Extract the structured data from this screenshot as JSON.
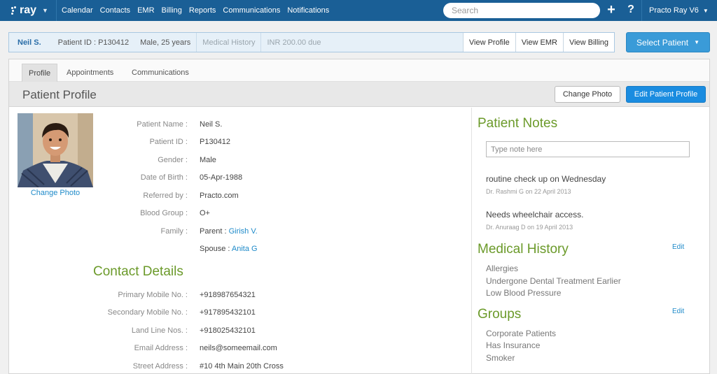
{
  "nav": {
    "logo": "ray",
    "links": [
      "Calendar",
      "Contacts",
      "EMR",
      "Billing",
      "Reports",
      "Communications",
      "Notifications"
    ],
    "search_placeholder": "Search",
    "plus": "+",
    "help": "?",
    "user": "Practo Ray V6"
  },
  "patient_bar": {
    "name": "Neil S.",
    "patient_id": "Patient ID : P130412",
    "gender_age": "Male, 25 years",
    "medical_history": "Medical History",
    "due": "INR 200.00 due",
    "view_profile": "View Profile",
    "view_emr": "View EMR",
    "view_billing": "View Billing",
    "select_patient": "Select Patient"
  },
  "tabs": [
    "Profile",
    "Appointments",
    "Communications"
  ],
  "profile": {
    "title": "Patient Profile",
    "change_photo_btn": "Change Photo",
    "edit_profile_btn": "Edit Patient Profile",
    "change_photo_link": "Change Photo",
    "fields": [
      {
        "label": "Patient Name :",
        "value": "Neil S."
      },
      {
        "label": "Patient ID :",
        "value": "P130412"
      },
      {
        "label": "Gender :",
        "value": "Male"
      },
      {
        "label": "Date of Birth :",
        "value": "05-Apr-1988"
      },
      {
        "label": "Referred by :",
        "value": "Practo.com"
      },
      {
        "label": "Blood Group :",
        "value": "O+"
      }
    ],
    "family_label": "Family :",
    "family": [
      {
        "relation": "Parent : ",
        "name": "Girish V."
      },
      {
        "relation": "Spouse : ",
        "name": "Anita G"
      }
    ],
    "contact_title": "Contact Details",
    "contacts": [
      {
        "label": "Primary Mobile No. :",
        "value": "+918987654321"
      },
      {
        "label": "Secondary Mobile No. :",
        "value": "+917895432101"
      },
      {
        "label": "Land Line Nos. :",
        "value": "+918025432101"
      },
      {
        "label": "Email Address :",
        "value": "neils@someemail.com"
      },
      {
        "label": "Street Address :",
        "value": "#10 4th Main 20th Cross"
      }
    ]
  },
  "notes": {
    "title": "Patient Notes",
    "placeholder": "Type note here",
    "items": [
      {
        "text": "routine check up on Wednesday",
        "meta": "Dr. Rashmi G on 22 April 2013"
      },
      {
        "text": "Needs wheelchair access.",
        "meta": "Dr. Anuraag D on 19 April 2013"
      }
    ]
  },
  "medical_history": {
    "title": "Medical History",
    "edit": "Edit",
    "items": [
      "Allergies",
      "Undergone Dental Treatment Earlier",
      "Low Blood Pressure"
    ]
  },
  "groups": {
    "title": "Groups",
    "edit": "Edit",
    "items": [
      "Corporate Patients",
      "Has Insurance",
      "Smoker"
    ]
  }
}
